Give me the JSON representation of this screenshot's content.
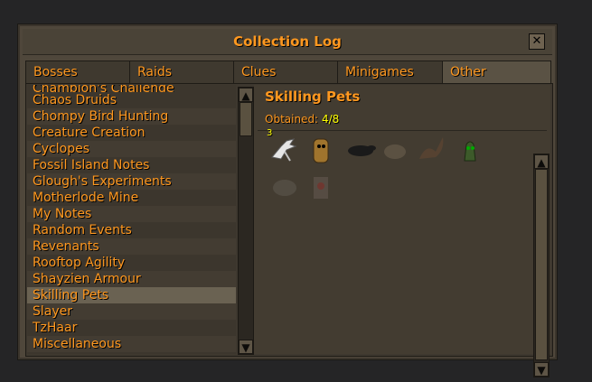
{
  "window": {
    "title": "Collection Log",
    "close_symbol": "✕"
  },
  "tabs": [
    "Bosses",
    "Raids",
    "Clues",
    "Minigames",
    "Other"
  ],
  "active_tab": "Other",
  "list": {
    "partial_top": "Champion's Challenge",
    "items": [
      "Chaos Druids",
      "Chompy Bird Hunting",
      "Creature Creation",
      "Cyclopes",
      "Fossil Island Notes",
      "Glough's Experiments",
      "Motherlode Mine",
      "My Notes",
      "Random Events",
      "Revenants",
      "Rooftop Agility",
      "Shayzien Armour",
      "Skilling Pets",
      "Slayer",
      "TzHaar",
      "Miscellaneous"
    ],
    "selected": "Skilling Pets"
  },
  "content": {
    "title": "Skilling Pets",
    "obtained_label": "Obtained:",
    "obtained_value": "4/8",
    "pets": [
      {
        "name": "heron-pet-icon",
        "obtained": true,
        "count": "3"
      },
      {
        "name": "rock-golem-pet-icon",
        "obtained": true
      },
      {
        "name": "beaver-pet-icon",
        "obtained": true
      },
      {
        "name": "baby-chinchompa-pet-icon",
        "obtained": false
      },
      {
        "name": "giant-squirrel-pet-icon",
        "obtained": false
      },
      {
        "name": "tangleroot-pet-icon",
        "obtained": true
      },
      {
        "name": "rocky-pet-icon",
        "obtained": false
      },
      {
        "name": "rift-guardian-pet-icon",
        "obtained": false
      }
    ]
  },
  "colors": {
    "accent": "#ff981f",
    "highlight": "#ffff00"
  }
}
